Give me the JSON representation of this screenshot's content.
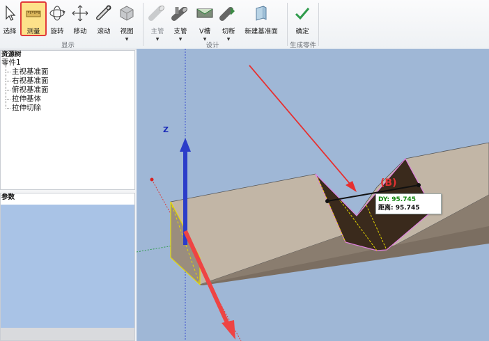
{
  "toolbar": {
    "tools": [
      {
        "id": "select",
        "label": "选择",
        "icon": "cursor-icon",
        "active": false,
        "disabled": false
      },
      {
        "id": "measure",
        "label": "测量",
        "icon": "ruler-icon",
        "active": true,
        "disabled": false
      },
      {
        "id": "rotate",
        "label": "旋转",
        "icon": "rotate-icon",
        "active": false,
        "disabled": false
      },
      {
        "id": "move",
        "label": "移动",
        "icon": "move-icon",
        "active": false,
        "disabled": false
      },
      {
        "id": "scroll",
        "label": "滚动",
        "icon": "scroll-icon",
        "active": false,
        "disabled": false
      },
      {
        "id": "view",
        "label": "视图",
        "icon": "cube-icon",
        "active": false,
        "disabled": false
      },
      {
        "id": "main-pipe",
        "label": "主管",
        "icon": "pipe-icon",
        "active": false,
        "disabled": true
      },
      {
        "id": "branch-pipe",
        "label": "支管",
        "icon": "branch-pipe-icon",
        "active": false,
        "disabled": false
      },
      {
        "id": "v-groove",
        "label": "V槽",
        "icon": "v-groove-icon",
        "active": false,
        "disabled": false
      },
      {
        "id": "cut",
        "label": "切断",
        "icon": "cut-icon",
        "active": false,
        "disabled": false
      },
      {
        "id": "new-datum",
        "label": "新建基准面",
        "icon": "datum-plane-icon",
        "active": false,
        "disabled": false
      },
      {
        "id": "confirm",
        "label": "确定",
        "icon": "check-icon",
        "active": false,
        "disabled": false
      }
    ],
    "groups": {
      "display": "显示",
      "design": "设计",
      "generate": "生成零件"
    }
  },
  "resource_tree": {
    "title": "资源树",
    "root": "零件1",
    "items": [
      "主视基准面",
      "右视基准面",
      "俯视基准面",
      "拉伸基体",
      "拉伸切除"
    ]
  },
  "params": {
    "title": "参数"
  },
  "viewport": {
    "axis_z_label": "Z",
    "measure_label": "(B)",
    "dy": "DY: 95.745",
    "distance": "距离: 95.745"
  },
  "colors": {
    "active_tool_bg": "#fde28a",
    "active_tool_border": "#e23b3b",
    "viewport_bg": "#9fb7d6",
    "beam": "#c2b6a6",
    "cut_face": "#3a2a1c"
  }
}
